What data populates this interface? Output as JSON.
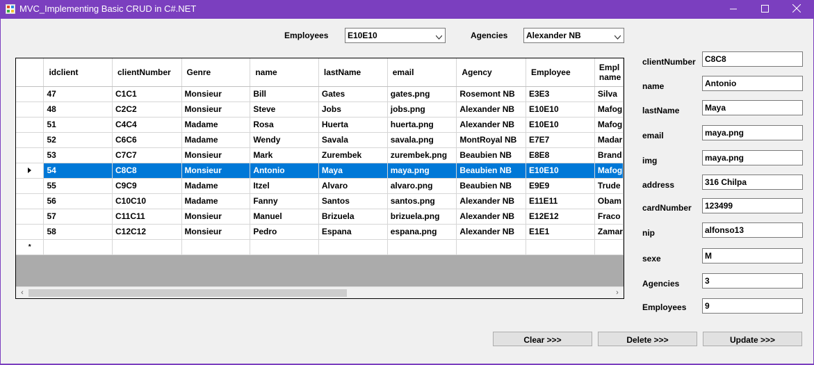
{
  "window": {
    "title": "MVC_Implementing Basic CRUD in C#.NET",
    "accent": "#7b3fbf"
  },
  "filters": {
    "employees_label": "Employees",
    "employees_value": "E10E10",
    "agencies_label": "Agencies",
    "agencies_value": "Alexander NB"
  },
  "grid": {
    "columns": [
      "idclient",
      "clientNumber",
      "Genre",
      "name",
      "lastName",
      "email",
      "Agency",
      "Employee",
      "Empl name"
    ],
    "rows": [
      [
        "47",
        "C1C1",
        "Monsieur",
        "Bill",
        "Gates",
        "gates.png",
        "Rosemont NB",
        "E3E3",
        "Silva"
      ],
      [
        "48",
        "C2C2",
        "Monsieur",
        "Steve",
        "Jobs",
        "jobs.png",
        "Alexander NB",
        "E10E10",
        "Mafog"
      ],
      [
        "51",
        "C4C4",
        "Madame",
        "Rosa",
        "Huerta",
        "huerta.png",
        "Alexander NB",
        "E10E10",
        "Mafog"
      ],
      [
        "52",
        "C6C6",
        "Madame",
        "Wendy",
        "Savala",
        "savala.png",
        "MontRoyal NB",
        "E7E7",
        "Madar"
      ],
      [
        "53",
        "C7C7",
        "Monsieur",
        "Mark",
        "Zurembek",
        "zurembek.png",
        "Beaubien NB",
        "E8E8",
        "Brand"
      ],
      [
        "54",
        "C8C8",
        "Monsieur",
        "Antonio",
        "Maya",
        "maya.png",
        "Beaubien NB",
        "E10E10",
        "Mafog"
      ],
      [
        "55",
        "C9C9",
        "Madame",
        "Itzel",
        "Alvaro",
        "alvaro.png",
        "Beaubien NB",
        "E9E9",
        "Trude"
      ],
      [
        "56",
        "C10C10",
        "Madame",
        "Fanny",
        "Santos",
        "santos.png",
        "Alexander NB",
        "E11E11",
        "Obam"
      ],
      [
        "57",
        "C11C11",
        "Monsieur",
        "Manuel",
        "Brizuela",
        "brizuela.png",
        "Alexander NB",
        "E12E12",
        "Fraco"
      ],
      [
        "58",
        "C12C12",
        "Monsieur",
        "Pedro",
        "Espana",
        "espana.png",
        "Alexander NB",
        "E1E1",
        "Zamar"
      ]
    ],
    "selected_row_index": 5,
    "new_row_marker": "*"
  },
  "form": {
    "fields": [
      {
        "label": "clientNumber",
        "value": "C8C8"
      },
      {
        "label": "name",
        "value": "Antonio"
      },
      {
        "label": "lastName",
        "value": "Maya"
      },
      {
        "label": "email",
        "value": "maya.png"
      },
      {
        "label": "img",
        "value": "maya.png"
      },
      {
        "label": "address",
        "value": "316 Chilpa"
      },
      {
        "label": "cardNumber",
        "value": "123499"
      },
      {
        "label": "nip",
        "value": "alfonso13"
      },
      {
        "label": "sexe",
        "value": "M"
      },
      {
        "label": "Agencies",
        "value": "3"
      },
      {
        "label": "Employees",
        "value": "9"
      }
    ]
  },
  "buttons": {
    "clear": "Clear >>>",
    "delete": "Delete >>>",
    "update": "Update >>>"
  }
}
